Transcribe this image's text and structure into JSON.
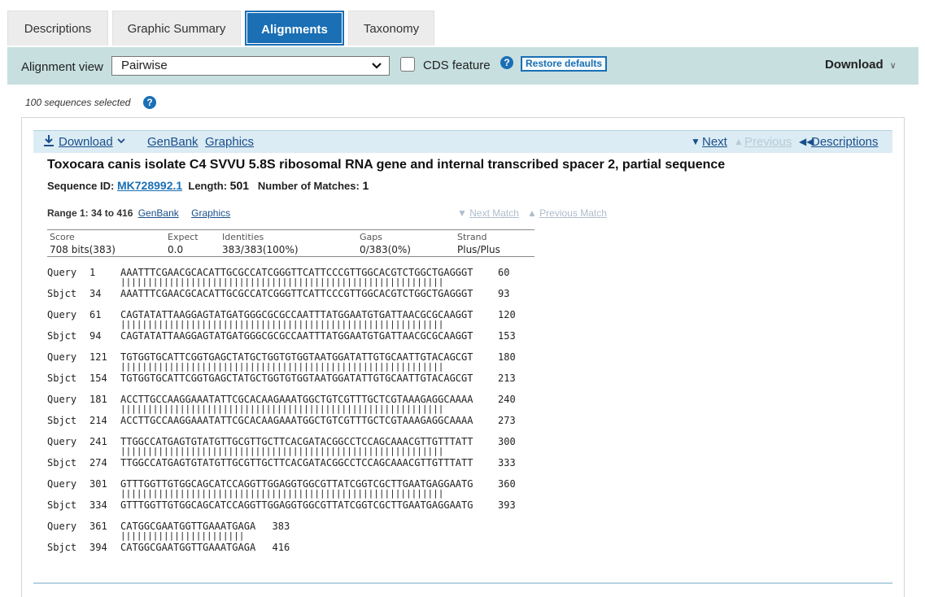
{
  "tabs": [
    {
      "label": "Descriptions",
      "active": false
    },
    {
      "label": "Graphic Summary",
      "active": false
    },
    {
      "label": "Alignments",
      "active": true
    },
    {
      "label": "Taxonomy",
      "active": false
    }
  ],
  "toolbar": {
    "view_label": "Alignment view",
    "view_value": "Pairwise",
    "cds_label": "CDS feature",
    "cds_checked": false,
    "restore_label": "Restore defaults",
    "download_label": "Download"
  },
  "selection": {
    "text": "100 sequences selected"
  },
  "result": {
    "download_label": "Download",
    "genbank_label": "GenBank",
    "graphics_label": "Graphics",
    "next_label": "Next",
    "previous_label": "Previous",
    "descriptions_label": "Descriptions",
    "title": "Toxocara canis isolate C4 SVVU 5.8S ribosomal RNA gene and internal transcribed spacer 2, partial sequence",
    "seqid_label": "Sequence ID:",
    "seqid": "MK728992.1",
    "length_label": "Length:",
    "length": "501",
    "matches_label": "Number of Matches:",
    "matches": "1"
  },
  "range": {
    "text": "Range 1: 34 to 416",
    "genbank_label": "GenBank",
    "graphics_label": "Graphics",
    "next_match_label": "Next Match",
    "previous_match_label": "Previous Match"
  },
  "score": {
    "score_h": "Score",
    "score_v": "708 bits(383)",
    "expect_h": "Expect",
    "expect_v": "0.0",
    "identities_h": "Identities",
    "identities_v": "383/383(100%)",
    "gaps_h": "Gaps",
    "gaps_v": "0/383(0%)",
    "strand_h": "Strand",
    "strand_v": "Plus/Plus"
  },
  "alignment": [
    {
      "qs": "1",
      "q": "AAATTTCGAACGCACATTGCGCCATCGGGTTCATTCCCGTTGGCACGTCTGGCTGAGGGT",
      "qe": "60",
      "ss": "34",
      "s": "AAATTTCGAACGCACATTGCGCCATCGGGTTCATTCCCGTTGGCACGTCTGGCTGAGGGT",
      "se": "93"
    },
    {
      "qs": "61",
      "q": "CAGTATATTAAGGAGTATGATGGGCGCGCCAATTTATGGAATGTGATTAACGCGCAAGGT",
      "qe": "120",
      "ss": "94",
      "s": "CAGTATATTAAGGAGTATGATGGGCGCGCCAATTTATGGAATGTGATTAACGCGCAAGGT",
      "se": "153"
    },
    {
      "qs": "121",
      "q": "TGTGGTGCATTCGGTGAGCTATGCTGGTGTGGTAATGGATATTGTGCAATTGTACAGCGT",
      "qe": "180",
      "ss": "154",
      "s": "TGTGGTGCATTCGGTGAGCTATGCTGGTGTGGTAATGGATATTGTGCAATTGTACAGCGT",
      "se": "213"
    },
    {
      "qs": "181",
      "q": "ACCTTGCCAAGGAAATATTCGCACAAGAAATGGCTGTCGTTTGCTCGTAAAGAGGCAAAA",
      "qe": "240",
      "ss": "214",
      "s": "ACCTTGCCAAGGAAATATTCGCACAAGAAATGGCTGTCGTTTGCTCGTAAAGAGGCAAAA",
      "se": "273"
    },
    {
      "qs": "241",
      "q": "TTGGCCATGAGTGTATGTTGCGTTGCTTCACGATACGGCCTCCAGCAAACGTTGTTTATT",
      "qe": "300",
      "ss": "274",
      "s": "TTGGCCATGAGTGTATGTTGCGTTGCTTCACGATACGGCCTCCAGCAAACGTTGTTTATT",
      "se": "333"
    },
    {
      "qs": "301",
      "q": "GTTTGGTTGTGGCAGCATCCAGGTTGGAGGTGGCGTTATCGGTCGCTTGAATGAGGAATG",
      "qe": "360",
      "ss": "334",
      "s": "GTTTGGTTGTGGCAGCATCCAGGTTGGAGGTGGCGTTATCGGTCGCTTGAATGAGGAATG",
      "se": "393"
    },
    {
      "qs": "361",
      "q": "CATGGCGAATGGTTGAAATGAGA",
      "qe": "383",
      "ss": "394",
      "s": "CATGGCGAATGGTTGAAATGAGA",
      "se": "416"
    }
  ]
}
